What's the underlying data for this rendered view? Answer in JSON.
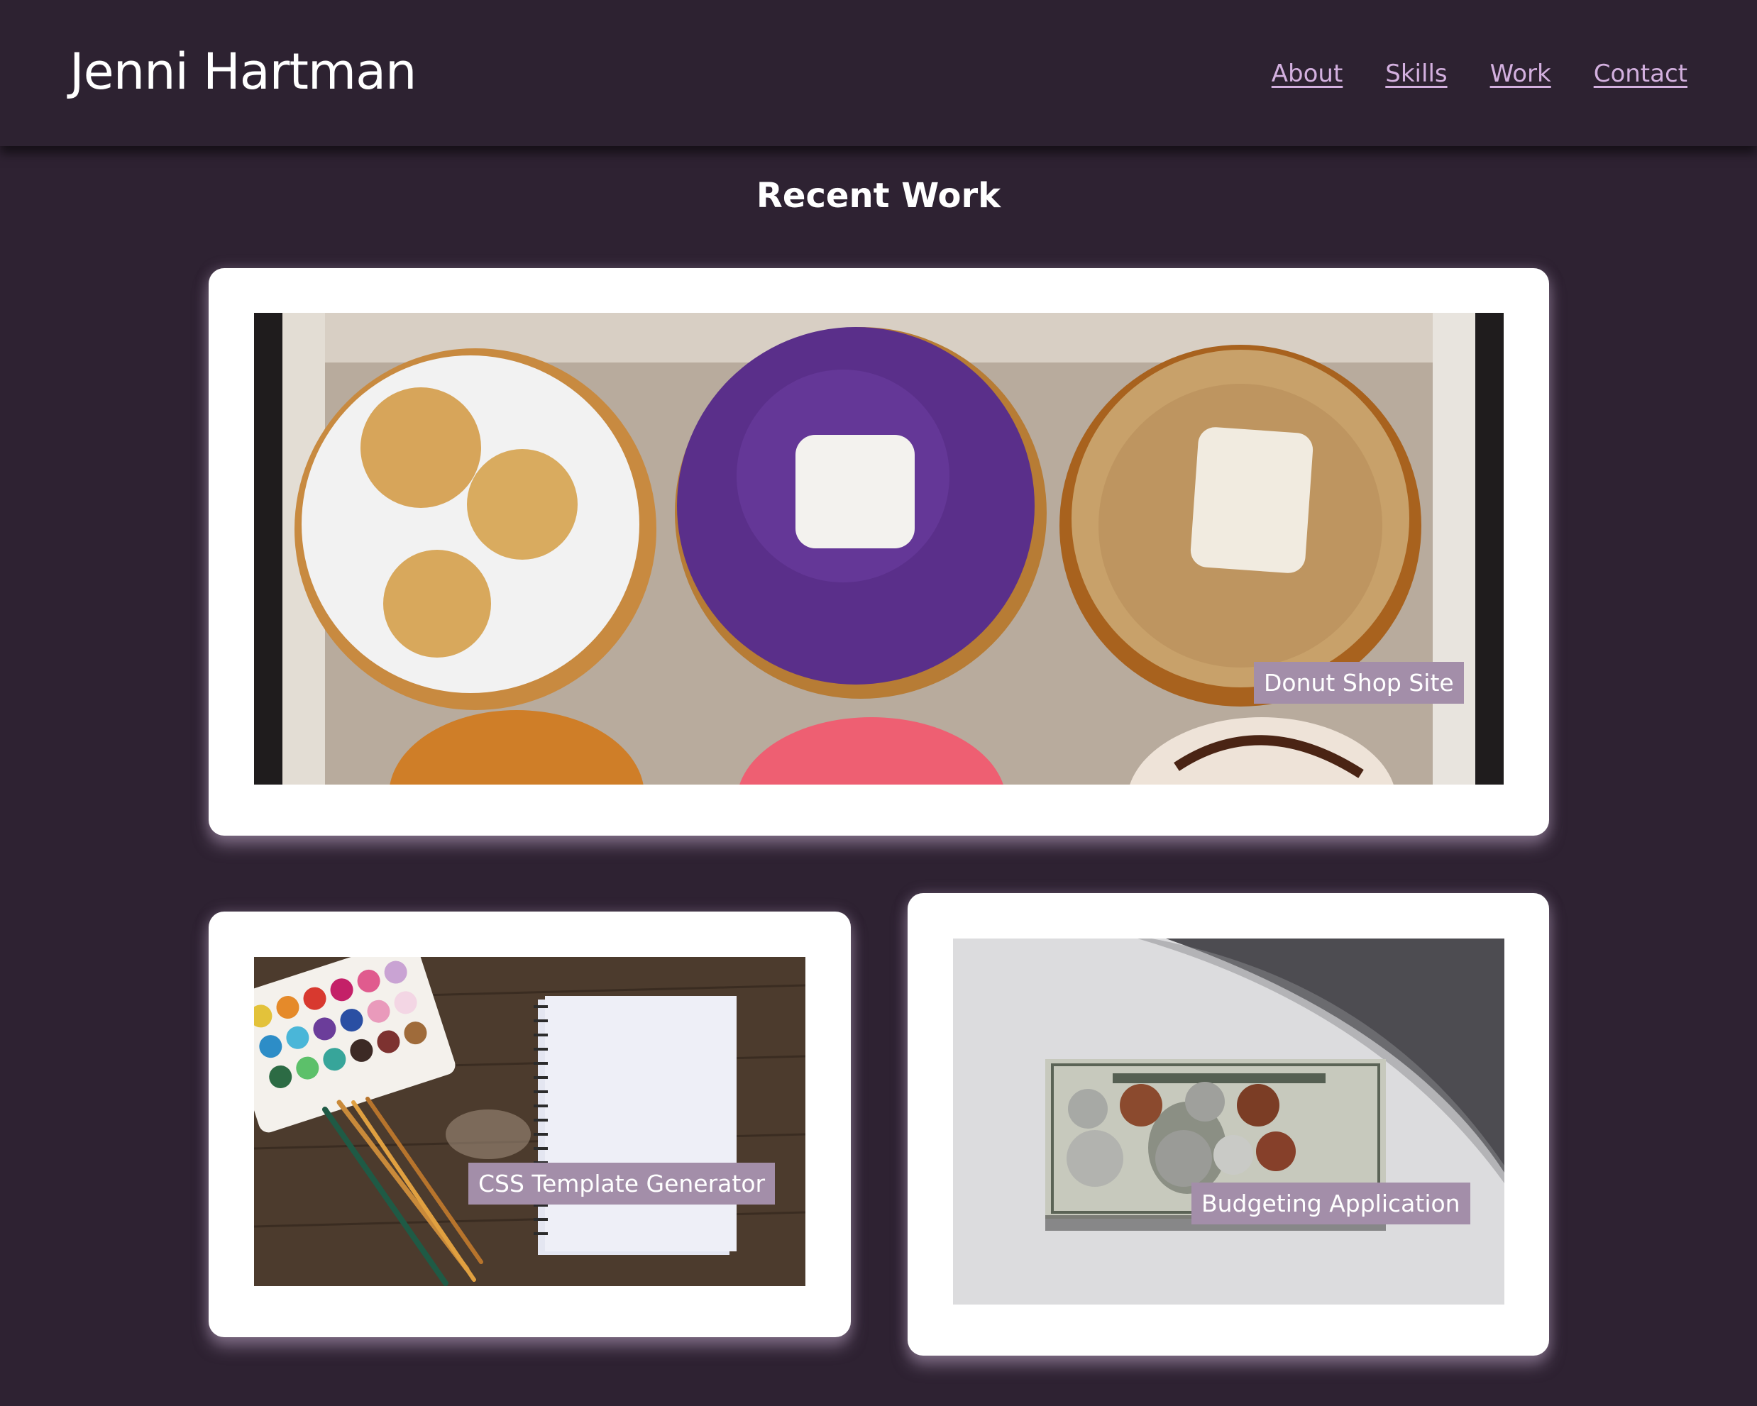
{
  "header": {
    "brand": "Jenni Hartman",
    "nav": [
      "About",
      "Skills",
      "Work",
      "Contact"
    ]
  },
  "work": {
    "title": "Recent Work",
    "projects": [
      {
        "label": "Donut Shop Site",
        "image": "donut-box-photo"
      },
      {
        "label": "CSS Template Generator",
        "image": "watercolor-notebook-photo"
      },
      {
        "label": "Budgeting Application",
        "image": "dollar-coins-photo"
      }
    ]
  },
  "colors": {
    "background": "#2e2232",
    "nav_link": "#d3b0df",
    "tag_background": "#a38ea9",
    "card": "#ffffff"
  }
}
